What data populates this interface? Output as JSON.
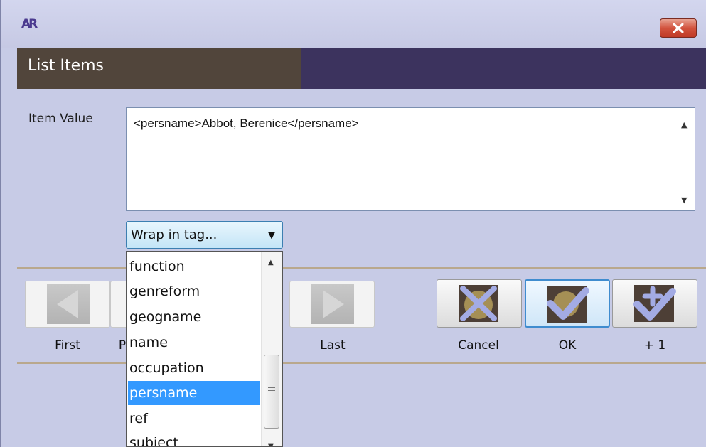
{
  "window": {
    "logo_text": "AR"
  },
  "header": {
    "title": "List Items"
  },
  "item_value": {
    "label": "Item Value",
    "text": "<persname>Abbot, Berenice</persname>"
  },
  "wrap_select": {
    "label": "Wrap in tag..."
  },
  "dropdown": {
    "items": [
      "function",
      "genreform",
      "geogname",
      "name",
      "occupation",
      "persname",
      "ref",
      "subject"
    ],
    "selected": "persname"
  },
  "nav": {
    "first": "First",
    "previous_partial": "P",
    "last": "Last"
  },
  "actions": {
    "cancel": "Cancel",
    "ok": "OK",
    "plus_one": "+ 1"
  },
  "colors": {
    "header_brown": "#51453b",
    "header_purple": "#3c335e",
    "background": "#c7cbe6",
    "selection": "#3399ff",
    "icon_blue": "#9ea6e0",
    "icon_dark": "#4d3f36"
  }
}
